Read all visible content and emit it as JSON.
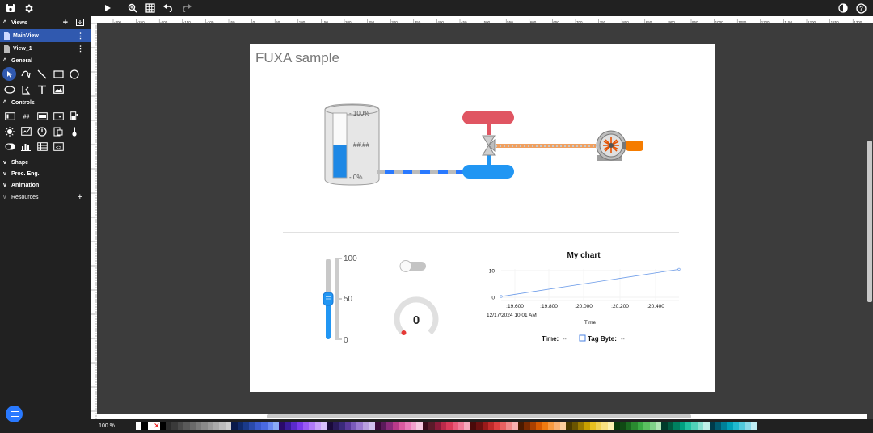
{
  "toolbar": {
    "save_icon": "save-icon",
    "settings_icon": "gear-icon"
  },
  "sidebar": {
    "views_label": "Views",
    "views": [
      {
        "label": "MainView",
        "active": true
      },
      {
        "label": "View_1",
        "active": false
      }
    ],
    "general_label": "General",
    "controls_label": "Controls",
    "shape_label": "Shape",
    "proc_eng_label": "Proc. Eng.",
    "animation_label": "Animation",
    "resources_label": "Resources"
  },
  "ruler": {
    "top_ticks": [
      "-300",
      "-250",
      "-200",
      "-150",
      "-100",
      "-50",
      "0",
      "50",
      "100",
      "150",
      "200",
      "250",
      "300",
      "350",
      "400",
      "450",
      "500",
      "550",
      "600",
      "650",
      "700",
      "750",
      "800",
      "850",
      "900",
      "950",
      "1000",
      "1050",
      "1100",
      "1150",
      "1200",
      "1250",
      "1300",
      "1350"
    ]
  },
  "page": {
    "title": "FUXA sample",
    "tank": {
      "top_label": "- 100%",
      "bottom_label": "- 0%",
      "value_text": "##.##",
      "fill_level": 0.5
    },
    "slider": {
      "max_label": "100",
      "mid_label": "50",
      "min_label": "0",
      "value": 0.5
    },
    "switch": {
      "on": false
    },
    "gauge": {
      "value": "0"
    },
    "chart": {
      "title": "My chart",
      "date_label": "12/17/2024 10:01 AM",
      "x_axis_title": "Time",
      "legend_time_label": "Time:",
      "legend_time_value": "--",
      "legend_tag_label": "Tag Byte:",
      "legend_tag_value": "--"
    }
  },
  "chart_data": {
    "type": "line",
    "title": "My chart",
    "xlabel": "Time",
    "ylabel": "",
    "x_ticks": [
      ":19.600",
      ":19.800",
      ":20.000",
      ":20.200",
      ":20.400"
    ],
    "y_ticks": [
      "0",
      "10"
    ],
    "ylim": [
      0,
      10
    ],
    "series": [
      {
        "name": "Tag Byte",
        "x": [
          0.0,
          1.0
        ],
        "y": [
          0.3,
          10.5
        ]
      }
    ]
  },
  "status": {
    "zoom": "100 %"
  },
  "colors": {
    "accent": "#3059af",
    "tank_fill": "#1e88e5",
    "red_tank": "#e05562",
    "blue_tank": "#2196f3",
    "motor_orange": "#f57c00",
    "pipe_orange": "#f0a060"
  },
  "palette": [
    "#ffffff",
    "#000000",
    "#ffffff",
    "#ff0000",
    "#000000",
    "#2b2b2b",
    "#3a3a3a",
    "#4a4a4a",
    "#5a5a5a",
    "#6a6a6a",
    "#7a7a7a",
    "#8a8a8a",
    "#9a9a9a",
    "#aaaaaa",
    "#bbbbbb",
    "#cccccc",
    "#0a1a4a",
    "#102a6a",
    "#1a3a8a",
    "#2a4aaa",
    "#3a5acc",
    "#4a6ae0",
    "#6a8af0",
    "#8aaaf5",
    "#2a0a6a",
    "#3a1a9a",
    "#5a2aca",
    "#7a3aea",
    "#9a5af5",
    "#b07af8",
    "#c8a0fa",
    "#d8c0fc",
    "#1a0a3a",
    "#2a1a5a",
    "#3a2a7a",
    "#5a3a9a",
    "#7a5aba",
    "#9a7ad0",
    "#b8a0e0",
    "#d0c0ee",
    "#3a0a3a",
    "#5a1a5a",
    "#8a2a7a",
    "#ba3a8a",
    "#da5aa0",
    "#ea7ab8",
    "#f0a0cc",
    "#f6c8e0",
    "#3a0a1a",
    "#5a1a2a",
    "#8a1a3a",
    "#ba2a4a",
    "#da3a5a",
    "#ea5a7a",
    "#f07a98",
    "#f6a8bc",
    "#4a0a0a",
    "#6a1010",
    "#9a1a1a",
    "#c02a2a",
    "#e04040",
    "#e86060",
    "#f08888",
    "#f8b0b0",
    "#4a1a00",
    "#7a2a00",
    "#aa4000",
    "#d85a00",
    "#f07a10",
    "#f89a40",
    "#fab070",
    "#fcd0a0",
    "#4a3a00",
    "#6a5400",
    "#9a7a00",
    "#c8a000",
    "#e8c020",
    "#f0d050",
    "#f8e080",
    "#fcf0b0",
    "#0a3a0a",
    "#104a14",
    "#1a6a20",
    "#2a8a30",
    "#3aaa44",
    "#5ac060",
    "#80d088",
    "#b0e4b4",
    "#003a2a",
    "#005a40",
    "#008060",
    "#00a080",
    "#20c0a0",
    "#50d0b8",
    "#88e0d0",
    "#c0f0e8",
    "#003a4a",
    "#005a70",
    "#008098",
    "#00a0b8",
    "#20b8d0",
    "#50c8dc",
    "#88d8e8",
    "#c0eef4"
  ]
}
